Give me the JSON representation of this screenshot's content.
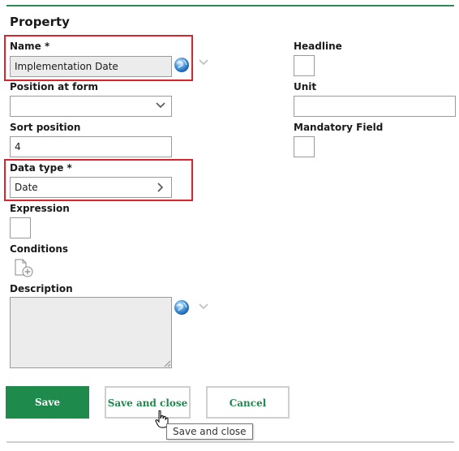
{
  "form": {
    "title": "Property",
    "name": {
      "label": "Name *",
      "value": "Implementation Date"
    },
    "position_at_form": {
      "label": "Position at form",
      "value": ""
    },
    "sort_position": {
      "label": "Sort position",
      "value": "4"
    },
    "data_type": {
      "label": "Data type *",
      "value": "Date"
    },
    "expression": {
      "label": "Expression"
    },
    "conditions": {
      "label": "Conditions"
    },
    "description": {
      "label": "Description",
      "value": ""
    },
    "headline": {
      "label": "Headline"
    },
    "unit": {
      "label": "Unit",
      "value": ""
    },
    "mandatory_field": {
      "label": "Mandatory Field"
    }
  },
  "actions": {
    "save": "Save",
    "save_and_close": "Save and close",
    "cancel": "Cancel"
  },
  "tooltip": "Save and close",
  "colors": {
    "accent": "#1e8a4c",
    "highlight": "#d9232d"
  },
  "icons": [
    "globe-icon",
    "chevron-down-icon",
    "chevron-right-icon",
    "add-document-icon",
    "hand-cursor-icon"
  ]
}
